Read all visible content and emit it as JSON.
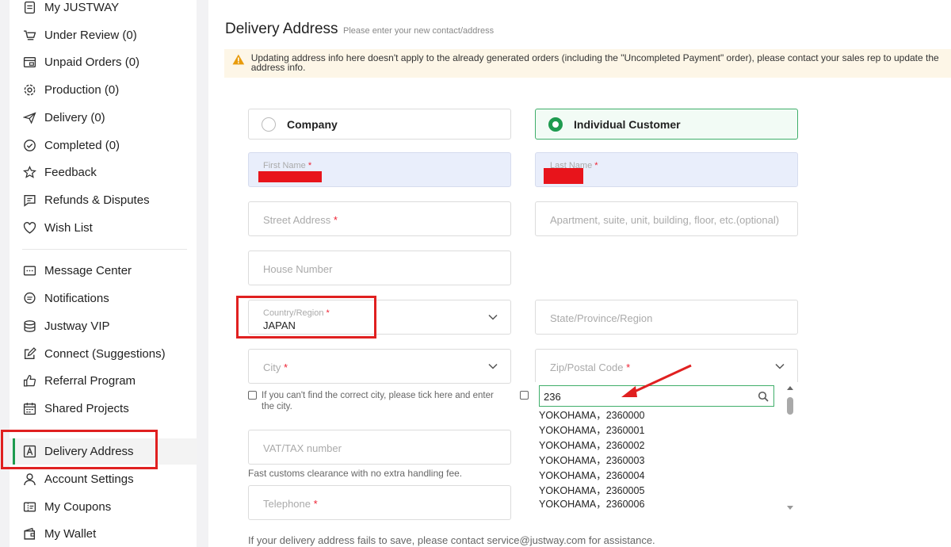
{
  "sidebar": {
    "group1": [
      {
        "label": "My JUSTWAY",
        "icon": "document-icon"
      },
      {
        "label": "Under Review (0)",
        "icon": "cart-icon"
      },
      {
        "label": "Unpaid Orders (0)",
        "icon": "bill-icon"
      },
      {
        "label": "Production (0)",
        "icon": "gear-icon"
      },
      {
        "label": "Delivery (0)",
        "icon": "plane-icon"
      },
      {
        "label": "Completed (0)",
        "icon": "check-circle-icon"
      },
      {
        "label": "Feedback",
        "icon": "star-icon"
      },
      {
        "label": "Refunds & Disputes",
        "icon": "chat-icon"
      },
      {
        "label": "Wish List",
        "icon": "heart-icon"
      }
    ],
    "group2": [
      {
        "label": "Message Center",
        "icon": "message-icon"
      },
      {
        "label": "Notifications",
        "icon": "bell-chat-icon"
      },
      {
        "label": "Justway VIP",
        "icon": "vip-icon"
      },
      {
        "label": "Connect (Suggestions)",
        "icon": "edit-icon"
      },
      {
        "label": "Referral Program",
        "icon": "thumbs-up-icon"
      },
      {
        "label": "Shared Projects",
        "icon": "calendar-icon"
      },
      {
        "label": "Delivery Address",
        "icon": "address-icon"
      },
      {
        "label": "Account Settings",
        "icon": "user-icon"
      },
      {
        "label": "My Coupons",
        "icon": "coupon-icon"
      },
      {
        "label": "My Wallet",
        "icon": "wallet-icon"
      }
    ]
  },
  "page": {
    "title": "Delivery Address",
    "subtitle": "Please enter your new contact/address",
    "notice": "Updating address info here doesn't apply to the already generated orders (including the \"Uncompleted Payment\" order), please contact your sales rep to update the address info."
  },
  "form": {
    "type_company": "Company",
    "type_individual": "Individual Customer",
    "first_name_label": "First Name",
    "last_name_label": "Last Name",
    "street_label": "Street Address",
    "apartment_placeholder": "Apartment, suite, unit, building, floor, etc.(optional)",
    "house_number_placeholder": "House Number",
    "country_label": "Country/Region",
    "country_value": "JAPAN",
    "state_placeholder": "State/Province/Region",
    "city_label": "City",
    "zip_label": "Zip/Postal Code",
    "city_checkbox_text": "If you can't find the correct city, please tick here and enter the city.",
    "vat_placeholder": "VAT/TAX number",
    "vat_hint": "Fast customs clearance with no extra handling fee.",
    "telephone_label": "Telephone",
    "required_mark": "*",
    "footer_note": "If your delivery address fails to save, please contact service@justway.com for assistance."
  },
  "zip_dropdown": {
    "search_value": "236",
    "options": [
      "YOKOHAMA，2360000",
      "YOKOHAMA，2360001",
      "YOKOHAMA，2360002",
      "YOKOHAMA，2360003",
      "YOKOHAMA，2360004",
      "YOKOHAMA，2360005",
      "YOKOHAMA，2360006"
    ]
  },
  "colors": {
    "accent_green": "#1e9b4f",
    "highlight_red": "#e02020",
    "filled_field_bg": "#e9eefb",
    "notice_bg": "#fdf6e7"
  }
}
